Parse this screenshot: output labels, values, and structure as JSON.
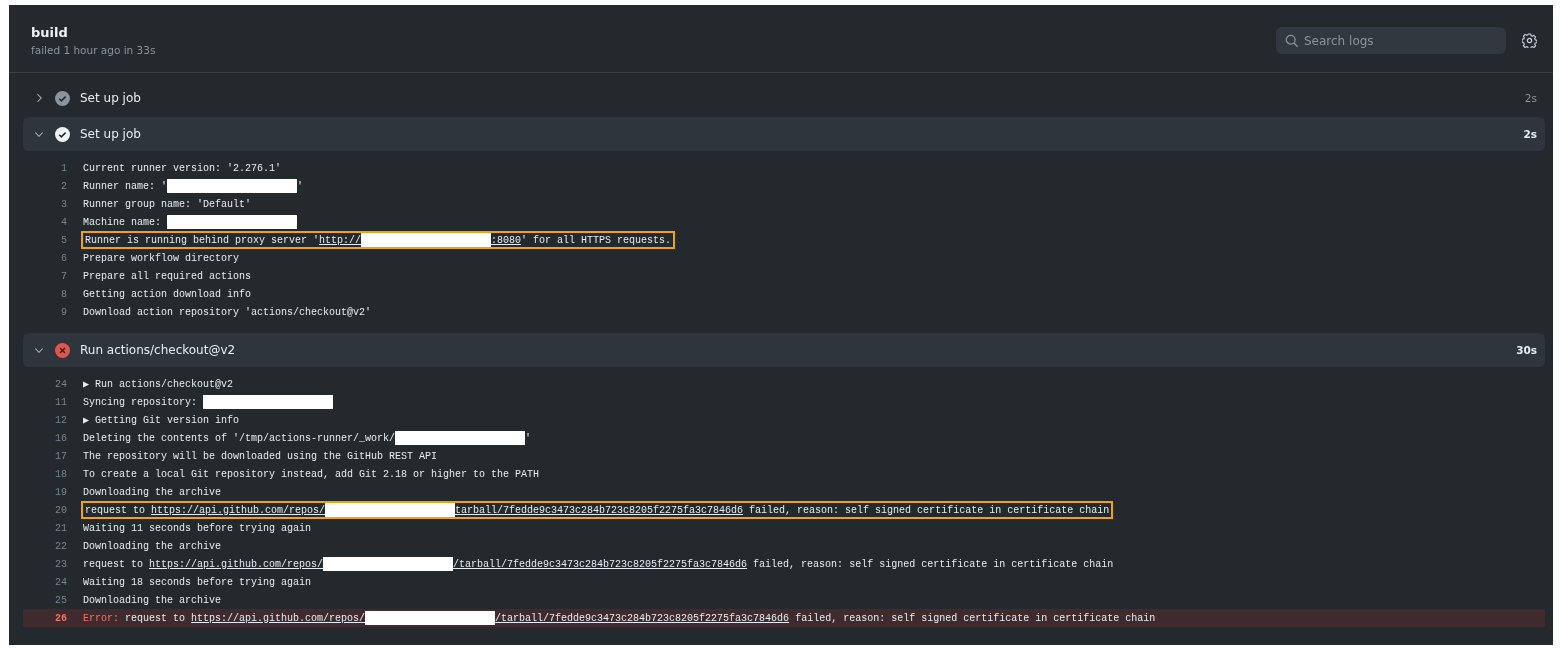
{
  "job": {
    "title": "build",
    "subtitle": "failed 1 hour ago in 33s"
  },
  "search": {
    "placeholder": "Search logs"
  },
  "steps": [
    {
      "title": "Set up job",
      "duration": "2s",
      "kind": "success",
      "expanded": false
    },
    {
      "title": "Set up job",
      "duration": "2s",
      "kind": "success",
      "expanded": true,
      "lines": [
        {
          "number": "1",
          "kind": "normal",
          "highlighted": false,
          "segments": [
            {
              "kind": "text",
              "text": "Current runner version: '2.276.1'"
            }
          ]
        },
        {
          "number": "2",
          "kind": "normal",
          "highlighted": false,
          "segments": [
            {
              "kind": "text",
              "text": "Runner name: '"
            },
            {
              "kind": "redacted"
            },
            {
              "kind": "text",
              "text": "'"
            }
          ]
        },
        {
          "number": "3",
          "kind": "normal",
          "highlighted": false,
          "segments": [
            {
              "kind": "text",
              "text": "Runner group name: 'Default'"
            }
          ]
        },
        {
          "number": "4",
          "kind": "normal",
          "highlighted": false,
          "segments": [
            {
              "kind": "text",
              "text": "Machine name: "
            },
            {
              "kind": "redacted"
            }
          ]
        },
        {
          "number": "5",
          "kind": "normal",
          "highlighted": true,
          "segments": [
            {
              "kind": "text",
              "text": "Runner is running behind proxy server '"
            },
            {
              "kind": "link",
              "text": "http://"
            },
            {
              "kind": "redacted"
            },
            {
              "kind": "link",
              "text": ":8080"
            },
            {
              "kind": "text",
              "text": "' for all HTTPS requests."
            }
          ]
        },
        {
          "number": "6",
          "kind": "normal",
          "highlighted": false,
          "segments": [
            {
              "kind": "text",
              "text": "Prepare workflow directory"
            }
          ]
        },
        {
          "number": "7",
          "kind": "normal",
          "highlighted": false,
          "segments": [
            {
              "kind": "text",
              "text": "Prepare all required actions"
            }
          ]
        },
        {
          "number": "8",
          "kind": "normal",
          "highlighted": false,
          "segments": [
            {
              "kind": "text",
              "text": "Getting action download info"
            }
          ]
        },
        {
          "number": "9",
          "kind": "normal",
          "highlighted": false,
          "segments": [
            {
              "kind": "text",
              "text": "Download action repository 'actions/checkout@v2'"
            }
          ]
        }
      ]
    },
    {
      "title": "Run actions/checkout@v2",
      "duration": "30s",
      "kind": "failure",
      "expanded": true,
      "lines": [
        {
          "number": "24",
          "kind": "normal",
          "highlighted": false,
          "segments": [
            {
              "kind": "text",
              "text": "▶ Run actions/checkout@v2"
            }
          ]
        },
        {
          "number": "11",
          "kind": "normal",
          "highlighted": false,
          "segments": [
            {
              "kind": "text",
              "text": "Syncing repository: "
            },
            {
              "kind": "redacted"
            }
          ]
        },
        {
          "number": "12",
          "kind": "normal",
          "highlighted": false,
          "segments": [
            {
              "kind": "text",
              "text": "▶ Getting Git version info"
            }
          ]
        },
        {
          "number": "16",
          "kind": "normal",
          "highlighted": false,
          "segments": [
            {
              "kind": "text",
              "text": "Deleting the contents of '/tmp/actions-runner/_work/"
            },
            {
              "kind": "redacted"
            },
            {
              "kind": "text",
              "text": "'"
            }
          ]
        },
        {
          "number": "17",
          "kind": "normal",
          "highlighted": false,
          "segments": [
            {
              "kind": "text",
              "text": "The repository will be downloaded using the GitHub REST API"
            }
          ]
        },
        {
          "number": "18",
          "kind": "normal",
          "highlighted": false,
          "segments": [
            {
              "kind": "text",
              "text": "To create a local Git repository instead, add Git 2.18 or higher to the PATH"
            }
          ]
        },
        {
          "number": "19",
          "kind": "normal",
          "highlighted": false,
          "segments": [
            {
              "kind": "text",
              "text": "Downloading the archive"
            }
          ]
        },
        {
          "number": "20",
          "kind": "normal",
          "highlighted": true,
          "segments": [
            {
              "kind": "text",
              "text": "request to "
            },
            {
              "kind": "link",
              "text": "https://api.github.com/repos/"
            },
            {
              "kind": "redacted"
            },
            {
              "kind": "link",
              "text": "tarball/7fedde9c3473c284b723c8205f2275fa3c7846d6"
            },
            {
              "kind": "text",
              "text": " failed, reason: self signed certificate in certificate chain"
            }
          ]
        },
        {
          "number": "21",
          "kind": "normal",
          "highlighted": false,
          "segments": [
            {
              "kind": "text",
              "text": "Waiting 11 seconds before trying again"
            }
          ]
        },
        {
          "number": "22",
          "kind": "normal",
          "highlighted": false,
          "segments": [
            {
              "kind": "text",
              "text": "Downloading the archive"
            }
          ]
        },
        {
          "number": "23",
          "kind": "normal",
          "highlighted": false,
          "segments": [
            {
              "kind": "text",
              "text": "request to "
            },
            {
              "kind": "link",
              "text": "https://api.github.com/repos/"
            },
            {
              "kind": "redacted"
            },
            {
              "kind": "link",
              "text": "/tarball/7fedde9c3473c284b723c8205f2275fa3c7846d6"
            },
            {
              "kind": "text",
              "text": " failed, reason: self signed certificate in certificate chain"
            }
          ]
        },
        {
          "number": "24",
          "kind": "normal",
          "highlighted": false,
          "segments": [
            {
              "kind": "text",
              "text": "Waiting 18 seconds before trying again"
            }
          ]
        },
        {
          "number": "25",
          "kind": "normal",
          "highlighted": false,
          "segments": [
            {
              "kind": "text",
              "text": "Downloading the archive"
            }
          ]
        },
        {
          "number": "26",
          "kind": "error",
          "highlighted": false,
          "segments": [
            {
              "kind": "error-label",
              "text": "Error:"
            },
            {
              "kind": "text",
              "text": " request to "
            },
            {
              "kind": "link",
              "text": "https://api.github.com/repos/"
            },
            {
              "kind": "redacted"
            },
            {
              "kind": "link",
              "text": "/tarball/7fedde9c3473c284b723c8205f2275fa3c7846d6"
            },
            {
              "kind": "text",
              "text": " failed, reason: self signed certificate in certificate chain"
            }
          ]
        }
      ]
    }
  ]
}
